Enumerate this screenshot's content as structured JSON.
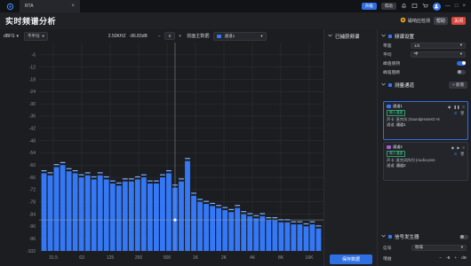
{
  "titlebar": {
    "tab_label": "RTA",
    "tab_close": "×",
    "btn_primary": "升级",
    "btn_secondary": "帮助",
    "min": "—",
    "max": "□",
    "close": "×"
  },
  "header": {
    "title": "实时频谱分析",
    "signal_check": "磁响应检测",
    "btn_a": "帮助",
    "btn_b": "关闭"
  },
  "toolbar": {
    "unit": "dBFS",
    "unit_arrow": "▾",
    "avg_select": "不平均",
    "readout_freq": "2.50KHZ",
    "readout_level": "-86.83dB",
    "stepper_minus": "−",
    "stepper_value": "0",
    "stepper_plus": "+",
    "main_data_label": "前面主数据:",
    "channel_select": "通道1",
    "saved_channels": "已捕获频谱"
  },
  "chart_data": {
    "type": "bar",
    "ylabel": "dBFS",
    "ylim": [
      -102,
      0
    ],
    "yticks": [
      -6,
      -12,
      -18,
      -24,
      -30,
      -36,
      -42,
      -48,
      -54,
      -60,
      -66,
      -72,
      -78,
      -84,
      -90,
      -96,
      -102
    ],
    "ytick_labels": [
      "-6",
      "-12",
      "-18",
      "-24",
      "-30",
      "-36",
      "-42",
      "-48",
      "-54",
      "-60",
      "-66",
      "-72",
      "-78",
      "-84",
      "-90",
      "-96",
      "-102"
    ],
    "xtick_labels": [
      "31.5",
      "63",
      "125",
      "250",
      "500",
      "1K",
      "2K",
      "4K",
      "8K",
      "16K"
    ],
    "bar_color": "#3478f6",
    "values": [
      -64,
      -65,
      -61,
      -60,
      -63,
      -64,
      -66,
      -65,
      -67,
      -65,
      -67,
      -69,
      -70,
      -68,
      -68,
      -67,
      -66,
      -69,
      -69,
      -66,
      -64,
      -71,
      -68,
      -58,
      -75,
      -78,
      -79,
      -80,
      -81,
      -82,
      -83,
      -81,
      -84,
      -85,
      -86,
      -85,
      -87,
      -87,
      -88,
      -88,
      -89,
      -89,
      -90,
      -89,
      -91
    ],
    "peak_values": [
      -62.5,
      -63.5,
      -59.5,
      -58.5,
      -61.5,
      -62.5,
      -64.5,
      -63.5,
      -65.5,
      -63.5,
      -65.5,
      -67.5,
      -68.5,
      -66.5,
      -66.5,
      -65.5,
      -64.5,
      -67.5,
      -67.5,
      -64.5,
      -62.5,
      -69.5,
      -66.5,
      -56.5,
      -73.5,
      -76.5,
      -77.5,
      -78.5,
      -79.5,
      -80.5,
      -81.5,
      -79.5,
      -82.5,
      -83.5,
      -84.5,
      -83.5,
      -85.5,
      -85.5,
      -86.5,
      -86.5,
      -87.5,
      -87.5,
      -88.5,
      -87.5,
      -89.5
    ],
    "cursor_level": -86.83
  },
  "side": {
    "start_button": "保存数据"
  },
  "right_panel": {
    "section1_title": "频谱设置",
    "rows": [
      {
        "label": "带宽",
        "value": "1/3"
      },
      {
        "label": "平均",
        "value": "中"
      }
    ],
    "toggle1_label": "峰值保持",
    "toggle2_label": "峰值阻断",
    "section2_title": "测量通道",
    "add_button": "+ 新增",
    "card1": {
      "name": "通道1",
      "chip": "输入通道",
      "device_label": "声卡:",
      "device_value": "麦克风 (SoundpreseHD Hi",
      "channel_label": "通道:",
      "channel_value": "通道1",
      "color": "#3478f6"
    },
    "card2": {
      "name": "通道2",
      "chip": "输入通道",
      "device_label": "声卡:",
      "device_value": "麦克风阵列 (Audio-pros",
      "channel_label": "通道:",
      "channel_value": "通道2",
      "color": "#a35bd6"
    },
    "section3_title": "信号发生器",
    "signal_label": "信号",
    "signal_value": "粉噪",
    "gain_label": "增益",
    "gain_minus": "−",
    "gain_value": "-5",
    "gain_plus": "+",
    "gain_unit": "dB"
  },
  "colors": {
    "accent": "#2f6fe4",
    "bars": "#3478f6",
    "background": "#1b1d21"
  }
}
